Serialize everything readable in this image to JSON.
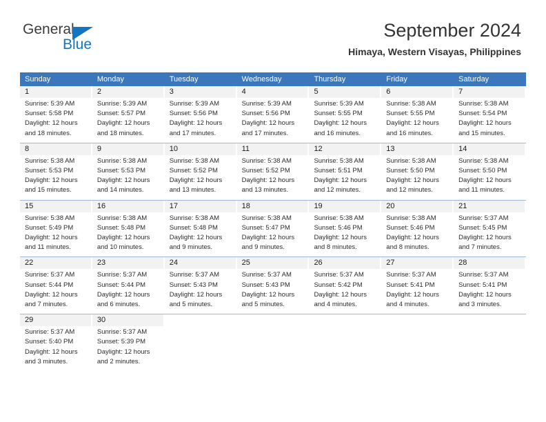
{
  "brand": {
    "name_top": "General",
    "name_bottom": "Blue",
    "color_blue": "#1474c4",
    "color_gray": "#3c3c3c",
    "triangle_icon": "triangle-icon"
  },
  "header": {
    "title": "September 2024",
    "subtitle": "Himaya, Western Visayas, Philippines"
  },
  "calendar": {
    "header_bg": "#3a77bd",
    "daynum_bg": "#f2f2f2",
    "weekdays": [
      "Sunday",
      "Monday",
      "Tuesday",
      "Wednesday",
      "Thursday",
      "Friday",
      "Saturday"
    ],
    "weeks": [
      [
        {
          "day": "1",
          "lines": [
            "Sunrise: 5:39 AM",
            "Sunset: 5:58 PM",
            "Daylight: 12 hours",
            "and 18 minutes."
          ]
        },
        {
          "day": "2",
          "lines": [
            "Sunrise: 5:39 AM",
            "Sunset: 5:57 PM",
            "Daylight: 12 hours",
            "and 18 minutes."
          ]
        },
        {
          "day": "3",
          "lines": [
            "Sunrise: 5:39 AM",
            "Sunset: 5:56 PM",
            "Daylight: 12 hours",
            "and 17 minutes."
          ]
        },
        {
          "day": "4",
          "lines": [
            "Sunrise: 5:39 AM",
            "Sunset: 5:56 PM",
            "Daylight: 12 hours",
            "and 17 minutes."
          ]
        },
        {
          "day": "5",
          "lines": [
            "Sunrise: 5:39 AM",
            "Sunset: 5:55 PM",
            "Daylight: 12 hours",
            "and 16 minutes."
          ]
        },
        {
          "day": "6",
          "lines": [
            "Sunrise: 5:38 AM",
            "Sunset: 5:55 PM",
            "Daylight: 12 hours",
            "and 16 minutes."
          ]
        },
        {
          "day": "7",
          "lines": [
            "Sunrise: 5:38 AM",
            "Sunset: 5:54 PM",
            "Daylight: 12 hours",
            "and 15 minutes."
          ]
        }
      ],
      [
        {
          "day": "8",
          "lines": [
            "Sunrise: 5:38 AM",
            "Sunset: 5:53 PM",
            "Daylight: 12 hours",
            "and 15 minutes."
          ]
        },
        {
          "day": "9",
          "lines": [
            "Sunrise: 5:38 AM",
            "Sunset: 5:53 PM",
            "Daylight: 12 hours",
            "and 14 minutes."
          ]
        },
        {
          "day": "10",
          "lines": [
            "Sunrise: 5:38 AM",
            "Sunset: 5:52 PM",
            "Daylight: 12 hours",
            "and 13 minutes."
          ]
        },
        {
          "day": "11",
          "lines": [
            "Sunrise: 5:38 AM",
            "Sunset: 5:52 PM",
            "Daylight: 12 hours",
            "and 13 minutes."
          ]
        },
        {
          "day": "12",
          "lines": [
            "Sunrise: 5:38 AM",
            "Sunset: 5:51 PM",
            "Daylight: 12 hours",
            "and 12 minutes."
          ]
        },
        {
          "day": "13",
          "lines": [
            "Sunrise: 5:38 AM",
            "Sunset: 5:50 PM",
            "Daylight: 12 hours",
            "and 12 minutes."
          ]
        },
        {
          "day": "14",
          "lines": [
            "Sunrise: 5:38 AM",
            "Sunset: 5:50 PM",
            "Daylight: 12 hours",
            "and 11 minutes."
          ]
        }
      ],
      [
        {
          "day": "15",
          "lines": [
            "Sunrise: 5:38 AM",
            "Sunset: 5:49 PM",
            "Daylight: 12 hours",
            "and 11 minutes."
          ]
        },
        {
          "day": "16",
          "lines": [
            "Sunrise: 5:38 AM",
            "Sunset: 5:48 PM",
            "Daylight: 12 hours",
            "and 10 minutes."
          ]
        },
        {
          "day": "17",
          "lines": [
            "Sunrise: 5:38 AM",
            "Sunset: 5:48 PM",
            "Daylight: 12 hours",
            "and 9 minutes."
          ]
        },
        {
          "day": "18",
          "lines": [
            "Sunrise: 5:38 AM",
            "Sunset: 5:47 PM",
            "Daylight: 12 hours",
            "and 9 minutes."
          ]
        },
        {
          "day": "19",
          "lines": [
            "Sunrise: 5:38 AM",
            "Sunset: 5:46 PM",
            "Daylight: 12 hours",
            "and 8 minutes."
          ]
        },
        {
          "day": "20",
          "lines": [
            "Sunrise: 5:38 AM",
            "Sunset: 5:46 PM",
            "Daylight: 12 hours",
            "and 8 minutes."
          ]
        },
        {
          "day": "21",
          "lines": [
            "Sunrise: 5:37 AM",
            "Sunset: 5:45 PM",
            "Daylight: 12 hours",
            "and 7 minutes."
          ]
        }
      ],
      [
        {
          "day": "22",
          "lines": [
            "Sunrise: 5:37 AM",
            "Sunset: 5:44 PM",
            "Daylight: 12 hours",
            "and 7 minutes."
          ]
        },
        {
          "day": "23",
          "lines": [
            "Sunrise: 5:37 AM",
            "Sunset: 5:44 PM",
            "Daylight: 12 hours",
            "and 6 minutes."
          ]
        },
        {
          "day": "24",
          "lines": [
            "Sunrise: 5:37 AM",
            "Sunset: 5:43 PM",
            "Daylight: 12 hours",
            "and 5 minutes."
          ]
        },
        {
          "day": "25",
          "lines": [
            "Sunrise: 5:37 AM",
            "Sunset: 5:43 PM",
            "Daylight: 12 hours",
            "and 5 minutes."
          ]
        },
        {
          "day": "26",
          "lines": [
            "Sunrise: 5:37 AM",
            "Sunset: 5:42 PM",
            "Daylight: 12 hours",
            "and 4 minutes."
          ]
        },
        {
          "day": "27",
          "lines": [
            "Sunrise: 5:37 AM",
            "Sunset: 5:41 PM",
            "Daylight: 12 hours",
            "and 4 minutes."
          ]
        },
        {
          "day": "28",
          "lines": [
            "Sunrise: 5:37 AM",
            "Sunset: 5:41 PM",
            "Daylight: 12 hours",
            "and 3 minutes."
          ]
        }
      ],
      [
        {
          "day": "29",
          "lines": [
            "Sunrise: 5:37 AM",
            "Sunset: 5:40 PM",
            "Daylight: 12 hours",
            "and 3 minutes."
          ]
        },
        {
          "day": "30",
          "lines": [
            "Sunrise: 5:37 AM",
            "Sunset: 5:39 PM",
            "Daylight: 12 hours",
            "and 2 minutes."
          ]
        },
        {
          "day": "",
          "lines": []
        },
        {
          "day": "",
          "lines": []
        },
        {
          "day": "",
          "lines": []
        },
        {
          "day": "",
          "lines": []
        },
        {
          "day": "",
          "lines": []
        }
      ]
    ]
  }
}
